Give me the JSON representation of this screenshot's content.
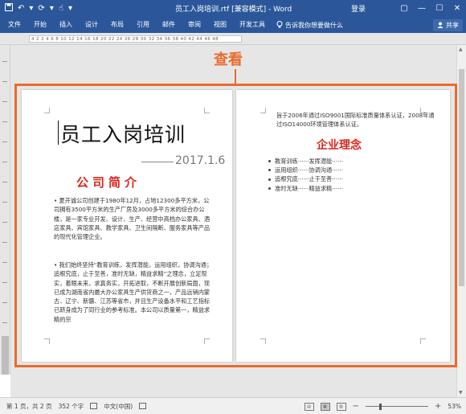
{
  "window": {
    "title": "员工入岗培训.rtf [兼容模式] - Word",
    "login_label": "登录",
    "controls": {
      "restore": "▢",
      "minimize": "—",
      "maximize": "☐",
      "close": "✕"
    }
  },
  "quick_access": {
    "save_icon": "floppy-disk",
    "undo": "↶",
    "redo": "↷",
    "repeat": "⟳",
    "customize": "▾",
    "touch_mode": "☝",
    "more": "▾"
  },
  "ribbon": {
    "tabs": [
      "文件",
      "开始",
      "插入",
      "设计",
      "布局",
      "引用",
      "邮件",
      "审阅",
      "视图",
      "开发工具"
    ],
    "tell_me": "告诉我你想要做什么",
    "share_label": "共享"
  },
  "ruler": {
    "ticks": "4 2 2 4 6 8 10 12 14 16 18 20 22 24 26 28 30 32 34 36 38 40 42 44 46 48"
  },
  "callout": {
    "label": "查看",
    "color": "#e96b2c"
  },
  "page1": {
    "title": "员工入岗培训",
    "date": "2017.1.6",
    "heading": "公司简介",
    "para1": "• 夏开诚公司创建于1980年12月，占地12300多平方米，公司拥有3500平方米的生产厂房及3000多平方米的综合办公楼，是一家专业开发、设计、生产、经营中高档办公家具、酒店家具、宾馆家具、教学家具、卫生间隔断、服务家具等产品的现代化管理企业。",
    "para2": "• 我们始终坚持“教育训练，发挥潜能，运用组织，协调沟通；追根究底，止于至善，准时无缺，精益求精”之理念，立足现实，着眼未来，求真务实，开拓进取，不断开展创新局面，现已成为湖南省内最大办公家具生产供货商之一，产品远销内蒙古、辽宁、新疆、江苏等省市，并且生产设备水平和工艺指标已跻身成为了同行业的参考标准。本公司以质量第一，精益求精的宗"
  },
  "page2": {
    "para": "旨于2006年通过ISO9001国际标准质量体系认证，2008年通过ISO14000环境管理体系认证。",
    "heading": "企业理念",
    "items": [
      "教育训练······发挥潜能······",
      "运用组织······协调沟通······",
      "追根究底······止于至善······",
      "准时无缺······精益求精······"
    ]
  },
  "statusbar": {
    "page_info": "第 1 页，共 2 页",
    "word_count": "352 个字",
    "language": "中文(中国)",
    "zoom_level": 0.53,
    "zoom_label": "53%",
    "zoom_minus": "−",
    "zoom_plus": "+"
  }
}
